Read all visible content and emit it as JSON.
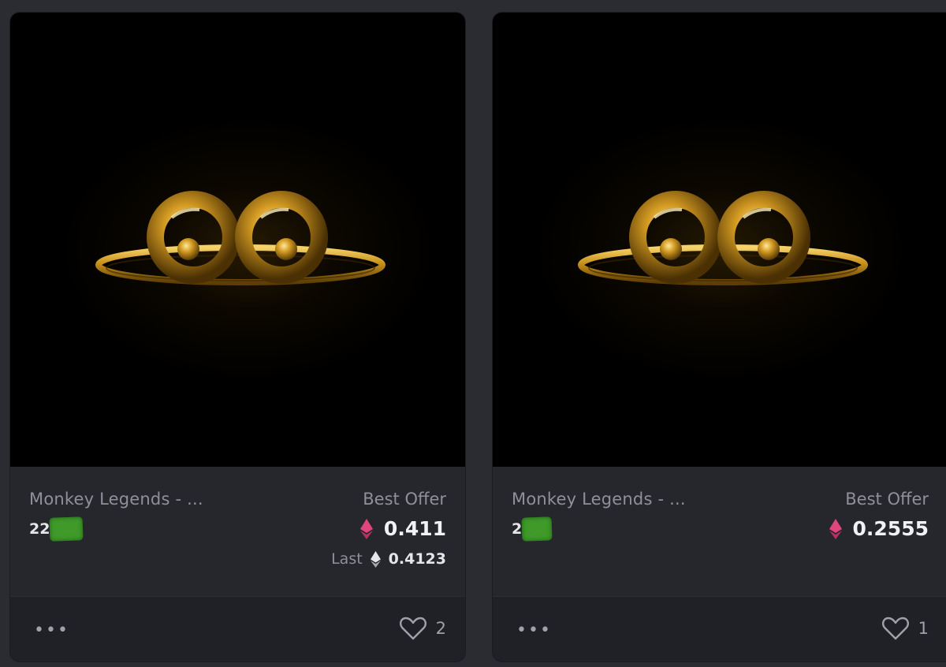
{
  "colors": {
    "background": "#2b2c31",
    "card": "#26272c",
    "price_eth_icon": "#e0457b",
    "last_eth_icon": "#e6e6ea",
    "redaction": "#3f9a2a"
  },
  "cards": [
    {
      "collection": "Monkey Legends - ...",
      "token_id_visible": "22",
      "best_offer_label": "Best Offer",
      "price_icon": "eth-diamond-icon",
      "price": "0.411",
      "last_label": "Last",
      "last_icon": "eth-diamond-icon",
      "last_price": "0.4123",
      "more_icon": "more-dots-icon",
      "more_label": "•••",
      "like_icon": "heart-icon",
      "likes": "2"
    },
    {
      "collection": "Monkey Legends - ...",
      "token_id_visible": "2",
      "best_offer_label": "Best Offer",
      "price_icon": "eth-diamond-icon",
      "price": "0.2555",
      "more_icon": "more-dots-icon",
      "more_label": "•••",
      "like_icon": "heart-icon",
      "likes": "1"
    }
  ]
}
